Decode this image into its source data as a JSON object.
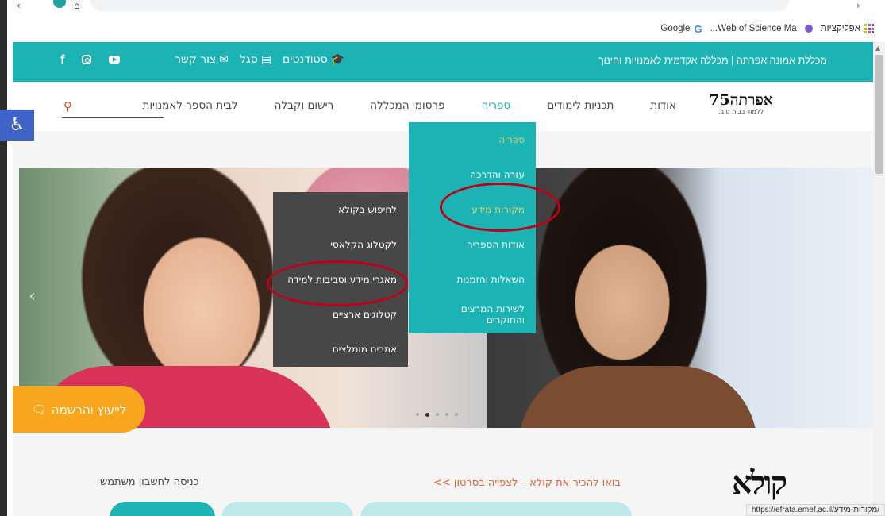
{
  "browser": {
    "bookmarks": [
      {
        "label": "אפליקציות",
        "icon": "apps-grid-icon"
      },
      {
        "label": "",
        "icon": "purple-dot-icon"
      },
      {
        "label": "Web of Science Ma...",
        "icon": "wos-icon"
      },
      {
        "label": "Google",
        "icon": "google-icon"
      }
    ],
    "status_url": "https://efrata.emef.ac.il/מקורות-מידע/"
  },
  "topbar": {
    "title": "מכללת אמונה אפרתה | מכללה אקדמית לאמנויות וחינוך",
    "links": [
      {
        "label": "סטודנטים",
        "icon": "graduation-cap-icon"
      },
      {
        "label": "סגל",
        "icon": "id-card-icon"
      },
      {
        "label": "צור קשר",
        "icon": "envelope-icon"
      }
    ],
    "social": [
      "facebook-icon",
      "instagram-icon",
      "youtube-icon"
    ]
  },
  "logo": {
    "main": "אפרתה75",
    "sub": "ללמוד בבית טוב."
  },
  "nav": {
    "items": [
      "אודות",
      "תכניות לימודים",
      "ספריה",
      "פרסומי המכללה",
      "רישום וקבלה",
      "לבית הספר לאמנויות"
    ],
    "active_index": 2
  },
  "library_menu": {
    "items": [
      "ספריה",
      "עזרה והדרכה",
      "מקורות מידע",
      "אודות הספריה",
      "השאלות והזמנות",
      "לשירות המרצים והחוקרים"
    ]
  },
  "sub_menu": {
    "items": [
      "לחיפוש בקולא",
      "לקטלוג הקלאסי",
      "מאגרי מידע וסביבות למידה",
      "קטלוגים ארציים",
      "אתרים מומלצים"
    ]
  },
  "hero": {
    "dots": 5,
    "active_dot": 1
  },
  "consult": {
    "label": "לייעוץ והרשמה",
    "icon": "chat-bubbles-icon"
  },
  "bottom": {
    "kola_logo": "קולא",
    "video_link": "בואו להכיר את קולא – לצפייה בסרטון >>",
    "login_title": "כניסה לחשבון משתמש"
  },
  "colors": {
    "teal": "#1bb3b3",
    "orange": "#f8a61e",
    "highlight": "#c00018",
    "dark_menu": "#474747"
  }
}
